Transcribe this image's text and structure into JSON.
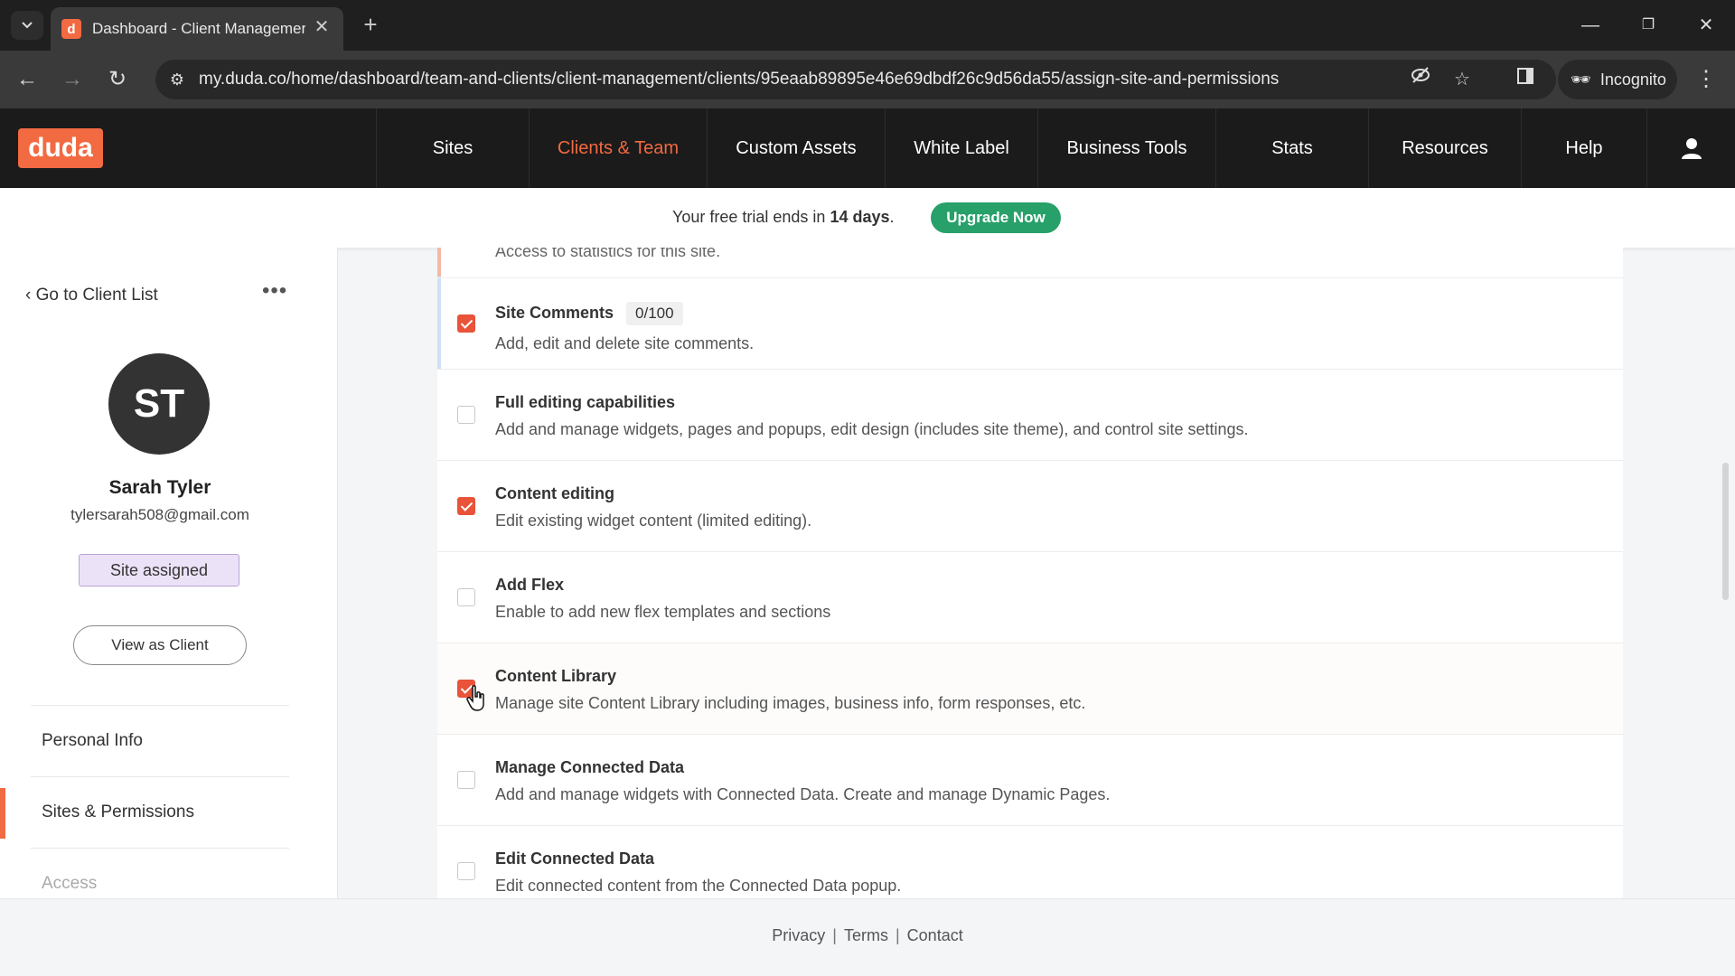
{
  "browser": {
    "tab_title": "Dashboard - Client Managemer",
    "favicon_letter": "d",
    "url": "my.duda.co/home/dashboard/team-and-clients/client-management/clients/95eaab89895e46e69dbdf26c9d56da55/assign-site-and-permissions",
    "incognito_label": "Incognito"
  },
  "app": {
    "logo": "duda",
    "nav": [
      "Sites",
      "Clients & Team",
      "Custom Assets",
      "White Label",
      "Business Tools",
      "Stats",
      "Resources",
      "Help"
    ],
    "active_nav": "Clients & Team",
    "accent_color": "#f26a42"
  },
  "trial": {
    "text_before": "Your free trial ends in ",
    "days": "14 days",
    "text_after": ".",
    "upgrade_label": "Upgrade Now"
  },
  "sidebar": {
    "back_label": "Go to Client List",
    "more_label": "•••",
    "avatar_initials": "ST",
    "client_name": "Sarah Tyler",
    "client_email": "tylersarah508@gmail.com",
    "badge": "Site assigned",
    "view_as_client": "View as Client",
    "items": [
      "Personal Info",
      "Sites & Permissions",
      "Access"
    ]
  },
  "permissions": {
    "partial_top_text": "Access to statistics for this site.",
    "rows": [
      {
        "title": "Site Comments",
        "count": "0/100",
        "desc": "Add, edit and delete site comments.",
        "checked": true
      },
      {
        "title": "Full editing capabilities",
        "desc": "Add and manage widgets, pages and popups, edit design (includes site theme), and control site settings.",
        "checked": false
      },
      {
        "title": "Content editing",
        "desc": "Edit existing widget content (limited editing).",
        "checked": true
      },
      {
        "title": "Add Flex",
        "desc": "Enable to add new flex templates and sections",
        "checked": false
      },
      {
        "title": "Content Library",
        "desc": "Manage site Content Library including images, business info, form responses, etc.",
        "checked": true
      },
      {
        "title": "Manage Connected Data",
        "desc": "Add and manage widgets with Connected Data. Create and manage Dynamic Pages.",
        "checked": false
      },
      {
        "title": "Edit Connected Data",
        "desc": "Edit connected content from the Connected Data popup.",
        "checked": false
      }
    ]
  },
  "footer": {
    "links": [
      "Privacy",
      "Terms",
      "Contact"
    ],
    "separator": "|"
  }
}
